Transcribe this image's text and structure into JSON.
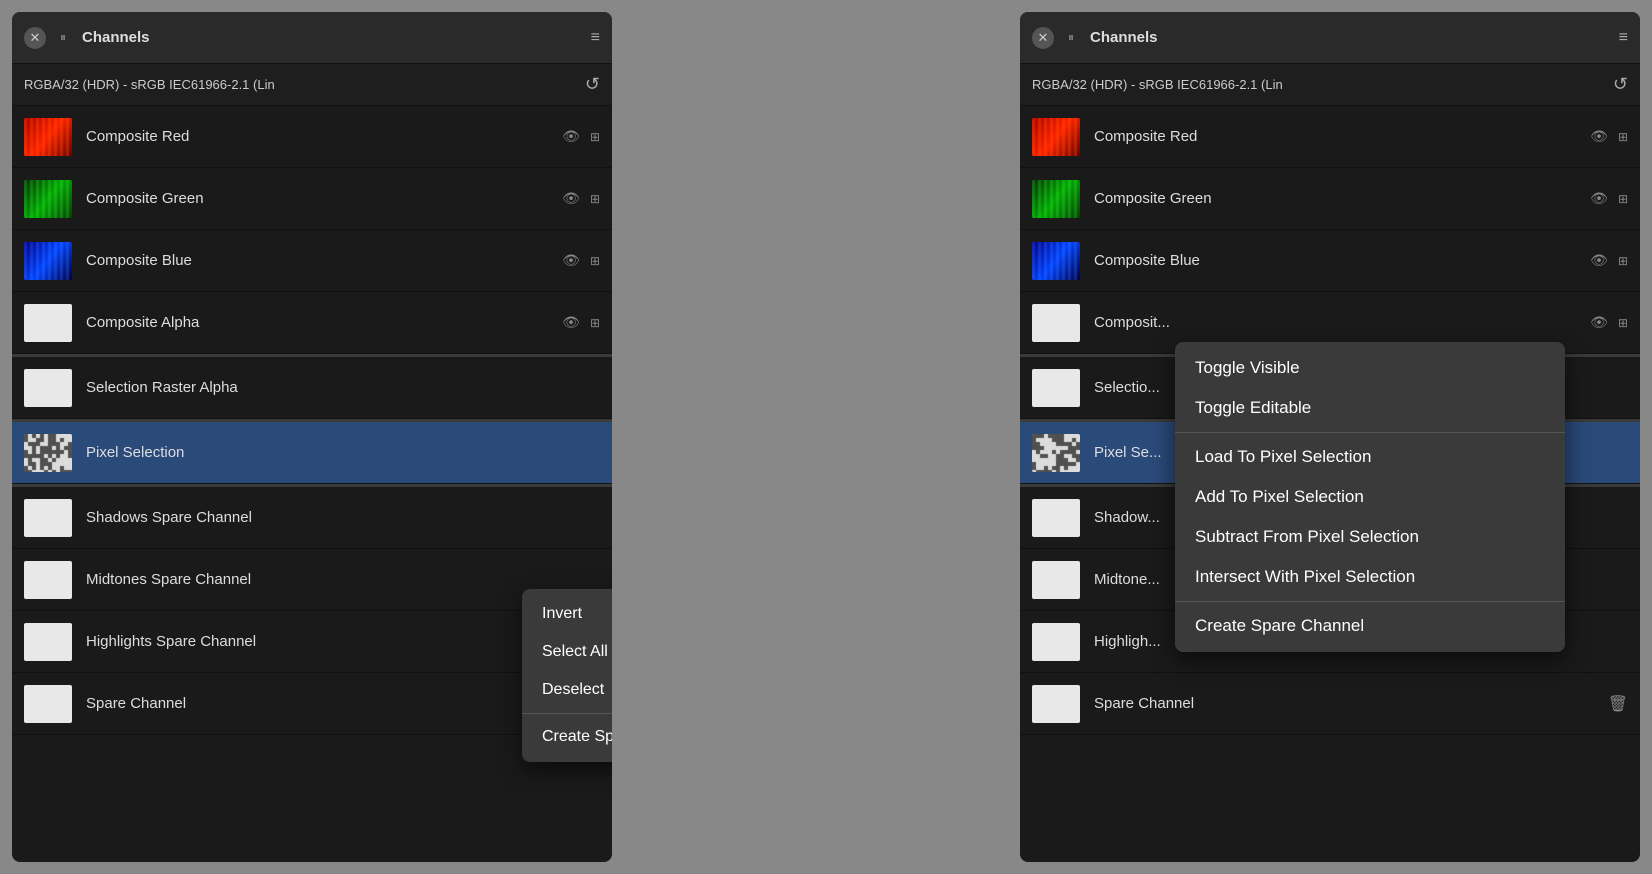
{
  "panel1": {
    "title": "Channels",
    "colorMode": "RGBA/32 (HDR) - sRGB IEC61966-2.1 (Lin",
    "channels": [
      {
        "name": "Composite Red",
        "thumb": "red",
        "hasEye": true,
        "hasSlider": true
      },
      {
        "name": "Composite Green",
        "thumb": "green",
        "hasEye": true,
        "hasSlider": true
      },
      {
        "name": "Composite Blue",
        "thumb": "blue",
        "hasEye": true,
        "hasSlider": true
      },
      {
        "name": "Composite Alpha",
        "thumb": "white",
        "hasEye": true,
        "hasSlider": true
      },
      {
        "name": "Selection Raster Alpha",
        "thumb": "white",
        "hasEye": false,
        "hasSlider": false
      },
      {
        "name": "Pixel Selection",
        "thumb": "pixel",
        "hasEye": false,
        "hasSlider": false,
        "selected": true
      },
      {
        "name": "Shadows Spare Channel",
        "thumb": "white",
        "hasEye": false,
        "hasSlider": false
      },
      {
        "name": "Midtones Spare Channel",
        "thumb": "white",
        "hasEye": false,
        "hasSlider": false
      },
      {
        "name": "Highlights Spare Channel",
        "thumb": "white",
        "hasEye": false,
        "hasSlider": false
      },
      {
        "name": "Spare Channel",
        "thumb": "white",
        "hasEye": false,
        "hasSlider": false,
        "showDelete": true
      }
    ],
    "contextMenu": {
      "items": [
        {
          "label": "Invert",
          "dividerAfter": false
        },
        {
          "label": "Select All",
          "dividerAfter": false
        },
        {
          "label": "Deselect",
          "dividerAfter": true
        },
        {
          "label": "Create Spare Channel",
          "dividerAfter": false
        }
      ]
    }
  },
  "panel2": {
    "title": "Channels",
    "colorMode": "RGBA/32 (HDR) - sRGB IEC61966-2.1 (Lin",
    "channels": [
      {
        "name": "Composite Red",
        "thumb": "red",
        "hasEye": true,
        "hasSlider": true
      },
      {
        "name": "Composite Green",
        "thumb": "green",
        "hasEye": true,
        "hasSlider": true
      },
      {
        "name": "Composite Blue",
        "thumb": "blue",
        "hasEye": true,
        "hasSlider": true
      },
      {
        "name": "Composite Alpha",
        "thumb": "white",
        "hasEye": true,
        "hasSlider": true,
        "truncated": true
      },
      {
        "name": "Selection Raster Alpha",
        "thumb": "white",
        "hasEye": false,
        "hasSlider": false,
        "truncated": true
      },
      {
        "name": "Pixel Selection",
        "thumb": "pixel",
        "hasEye": false,
        "hasSlider": false,
        "truncated": true,
        "selected": true
      },
      {
        "name": "Shadows Spare Channel",
        "thumb": "white",
        "hasEye": false,
        "hasSlider": false,
        "truncated": true
      },
      {
        "name": "Midtones Spare Channel",
        "thumb": "white",
        "hasEye": false,
        "hasSlider": false,
        "truncated": true
      },
      {
        "name": "Highlights Spare Channel",
        "thumb": "white",
        "hasEye": false,
        "hasSlider": false,
        "truncated": true
      },
      {
        "name": "Spare Channel",
        "thumb": "white",
        "hasEye": false,
        "hasSlider": false,
        "showDelete": true
      }
    ],
    "contextMenu": {
      "items": [
        {
          "label": "Toggle Visible",
          "dividerAfter": false
        },
        {
          "label": "Toggle Editable",
          "dividerAfter": true
        },
        {
          "label": "Load To Pixel Selection",
          "dividerAfter": false
        },
        {
          "label": "Add To Pixel Selection",
          "dividerAfter": false
        },
        {
          "label": "Subtract From Pixel Selection",
          "dividerAfter": false
        },
        {
          "label": "Intersect With Pixel Selection",
          "dividerAfter": true
        },
        {
          "label": "Create Spare Channel",
          "dividerAfter": false
        }
      ]
    }
  },
  "icons": {
    "close": "✕",
    "pause": "⏸",
    "menu": "≡",
    "reset": "↺",
    "eye": "👁",
    "sliders": "⊞",
    "delete": "🗑"
  }
}
